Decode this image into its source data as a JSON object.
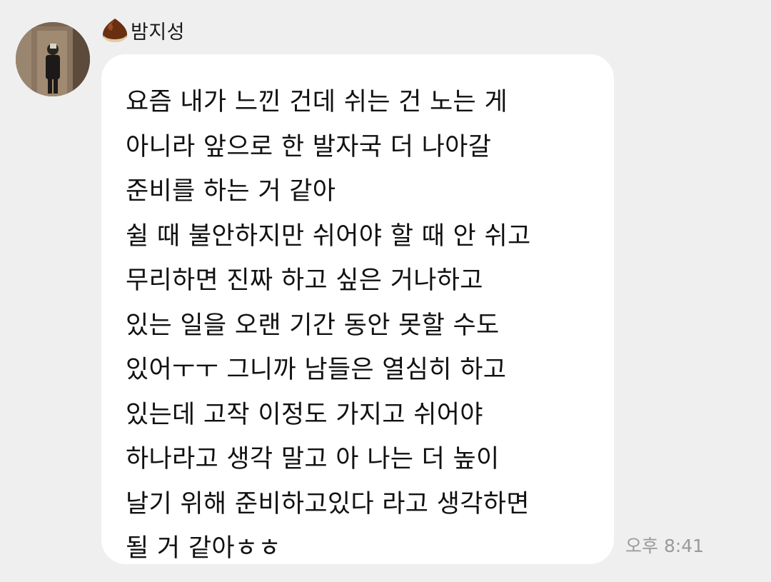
{
  "sender": {
    "name": "밤지성",
    "avatar_icon": "profile-photo",
    "badge_icon": "chestnut-icon"
  },
  "message": {
    "lines": [
      "요즘 내가 느낀 건데 쉬는 건 노는 게",
      "아니라 앞으로 한 발자국 더 나아갈",
      "준비를 하는 거 같아",
      "쉴 때 불안하지만 쉬어야 할 때 안 쉬고",
      "무리하면 진짜 하고 싶은 거나하고",
      "있는 일을 오랜 기간 동안 못할 수도",
      "있어ㅜㅜ 그니까 남들은 열심히 하고",
      "있는데 고작 이정도 가지고 쉬어야",
      "하나라고 생각 말고 아 나는 더 높이",
      "날기 위해 준비하고있다 라고 생각하면",
      "될 거 같아ㅎㅎ"
    ],
    "timestamp": "오후 8:41"
  },
  "colors": {
    "background": "#efefef",
    "bubble": "#ffffff",
    "text": "#111111",
    "timestamp": "#9a9a9a"
  }
}
